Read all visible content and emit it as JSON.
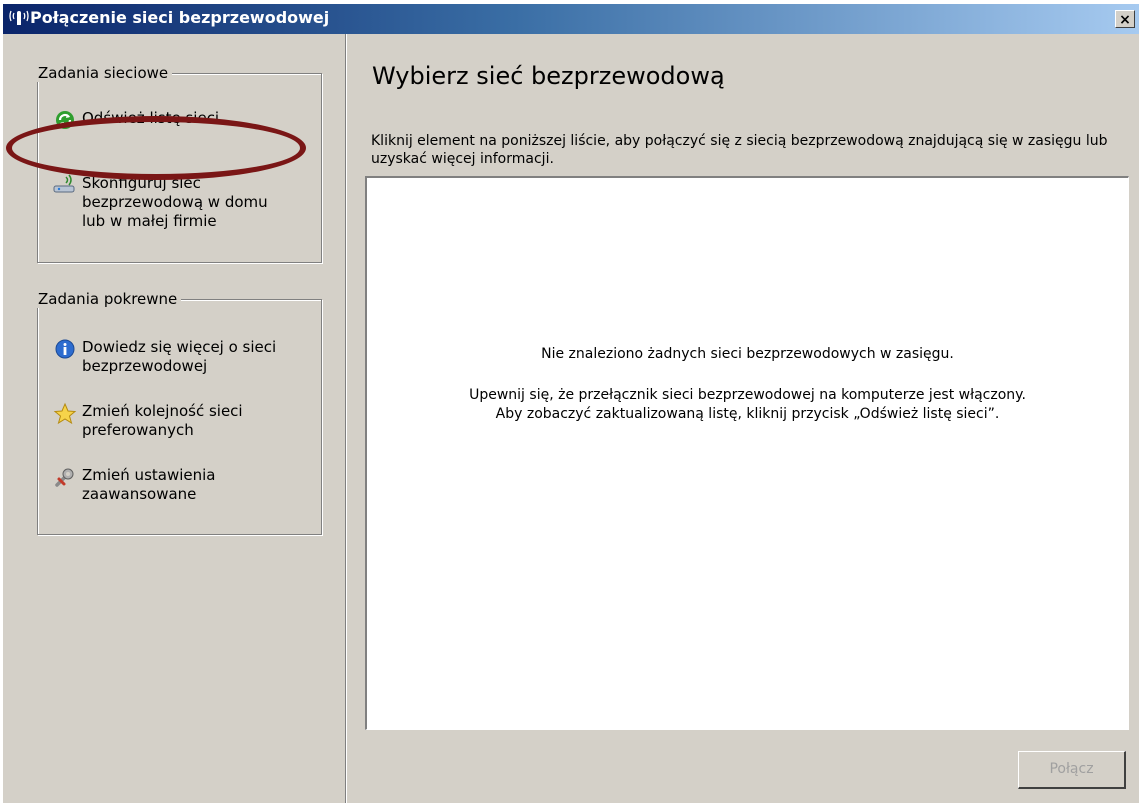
{
  "window": {
    "title": "Połączenie sieci bezprzewodowej",
    "close_label": "×"
  },
  "sidebar": {
    "network_tasks": {
      "heading": "Zadania sieciowe",
      "items": [
        {
          "label": "Odśwież listę sieci",
          "icon": "refresh-icon"
        },
        {
          "label": "Skonfiguruj sieć bezprzewodową w domu lub w małej firmie",
          "icon": "wireless-setup-icon"
        }
      ]
    },
    "related_tasks": {
      "heading": "Zadania pokrewne",
      "items": [
        {
          "label": "Dowiedz się więcej o sieci bezprzewodowej",
          "icon": "info-icon"
        },
        {
          "label": "Zmień kolejność sieci preferowanych",
          "icon": "star-icon"
        },
        {
          "label": "Zmień ustawienia zaawansowane",
          "icon": "settings-icon"
        }
      ]
    }
  },
  "main": {
    "heading": "Wybierz sieć bezprzewodową",
    "description": "Kliknij element na poniższej liście, aby połączyć się z siecią bezprzewodową znajdującą się w zasięgu lub uzyskać więcej informacji.",
    "empty_message": "Nie znaleziono żadnych sieci bezprzewodowych w zasięgu.",
    "hint_line1": "Upewnij się, że przełącznik sieci bezprzewodowej na komputerze jest włączony.",
    "hint_line2": "Aby zobaczyć zaktualizowaną listę, kliknij przycisk „Odśwież listę sieci”.",
    "connect_button": "Połącz"
  },
  "colors": {
    "titlebar_start": "#0a246a",
    "titlebar_end": "#a6caf0",
    "dialog_bg": "#d4d0c8",
    "highlight_oval": "#7a1616"
  }
}
